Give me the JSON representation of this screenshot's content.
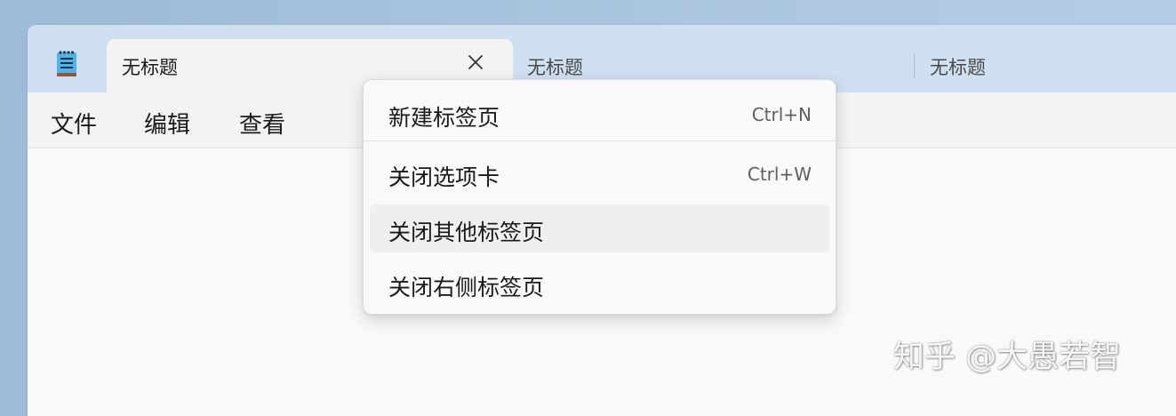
{
  "tabs": [
    {
      "title": "无标题",
      "active": true
    },
    {
      "title": "无标题",
      "active": false
    },
    {
      "title": "无标题",
      "active": false
    }
  ],
  "menubar": {
    "file": "文件",
    "edit": "编辑",
    "view": "查看"
  },
  "context_menu": {
    "items": [
      {
        "label": "新建标签页",
        "shortcut": "Ctrl+N"
      },
      {
        "label": "关闭选项卡",
        "shortcut": "Ctrl+W"
      },
      {
        "label": "关闭其他标签页",
        "shortcut": ""
      },
      {
        "label": "关闭右侧标签页",
        "shortcut": ""
      }
    ],
    "hovered_index": 2
  },
  "watermark": "知乎 @大愚若智",
  "icons": {
    "app": "notepad-icon",
    "close": "close-icon"
  },
  "colors": {
    "tabbar_bg": "#cfe0f0",
    "active_tab_bg": "#f3f3f3",
    "editor_bg": "#f9f9f9",
    "menu_hover_bg": "#efefef"
  }
}
